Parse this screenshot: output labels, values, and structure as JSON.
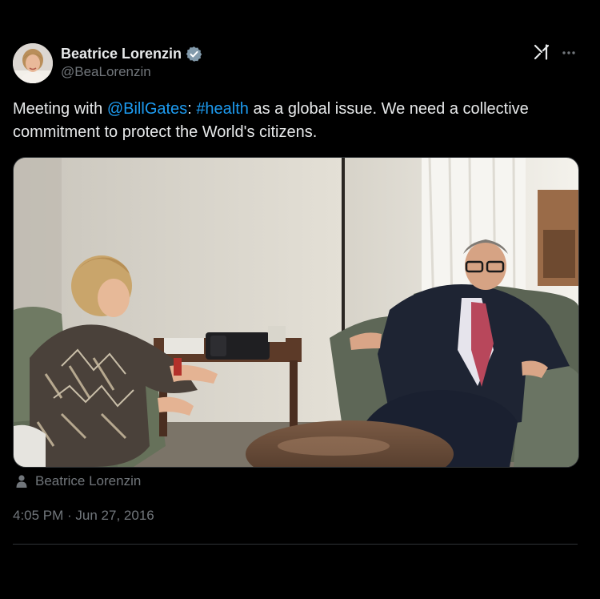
{
  "tweet": {
    "author": {
      "display_name": "Beatrice Lorenzin",
      "handle": "@BeaLorenzin",
      "verified": true
    },
    "text": {
      "prefix": "Meeting with ",
      "mention": "@BillGates",
      "separator": ": ",
      "hashtag": "#health",
      "suffix": " as a global issue. We need a collective commitment to protect the World's citizens."
    },
    "media": {
      "type": "photo"
    },
    "tagged_user": "Beatrice Lorenzin",
    "time": "4:05 PM",
    "dot": " · ",
    "date": "Jun 27, 2016"
  },
  "icons": {
    "verified": "verified-badge-icon",
    "grok": "grok-icon",
    "more": "more-options-icon",
    "tagged": "person-icon"
  },
  "colors": {
    "background": "#000000",
    "text_primary": "#e7e9ea",
    "text_secondary": "#71767b",
    "link": "#1d9bf0",
    "divider": "#2f3336"
  }
}
